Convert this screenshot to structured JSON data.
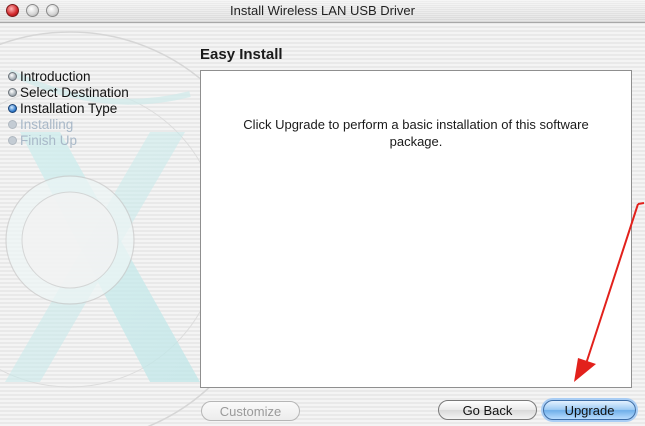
{
  "window": {
    "title": "Install Wireless LAN USB Driver"
  },
  "page": {
    "heading": "Easy Install"
  },
  "steps": [
    {
      "label": "Introduction",
      "state": "done"
    },
    {
      "label": "Select Destination",
      "state": "done"
    },
    {
      "label": "Installation Type",
      "state": "current"
    },
    {
      "label": "Installing",
      "state": "pending"
    },
    {
      "label": "Finish Up",
      "state": "pending"
    }
  ],
  "content": {
    "message": "Click Upgrade to perform a basic installation of this software package."
  },
  "buttons": {
    "customize": "Customize",
    "go_back": "Go Back",
    "upgrade": "Upgrade"
  },
  "colors": {
    "accent": "#6eaee9",
    "annotation_arrow": "#e2211c"
  },
  "icons": [
    "close-icon",
    "minimize-icon",
    "zoom-icon"
  ]
}
